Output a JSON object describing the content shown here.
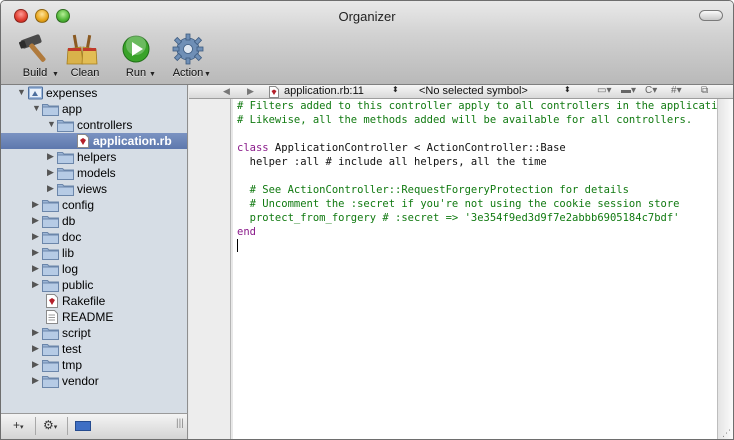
{
  "window": {
    "title": "Organizer"
  },
  "toolbar": {
    "items": [
      {
        "label": "Build",
        "icon": "hammer-icon"
      },
      {
        "label": "Clean",
        "icon": "broom-icon"
      },
      {
        "label": "Run",
        "icon": "run-icon"
      },
      {
        "label": "Action",
        "icon": "gear-icon"
      }
    ]
  },
  "sidebar": {
    "tree": [
      {
        "label": "expenses",
        "icon": "project-icon",
        "expanded": true
      },
      {
        "label": "app",
        "icon": "folder-icon",
        "expanded": true
      },
      {
        "label": "controllers",
        "icon": "folder-icon",
        "expanded": true
      },
      {
        "label": "application.rb",
        "icon": "ruby-file-icon",
        "selected": true
      },
      {
        "label": "helpers",
        "icon": "folder-icon",
        "expanded": false
      },
      {
        "label": "models",
        "icon": "folder-icon",
        "expanded": false
      },
      {
        "label": "views",
        "icon": "folder-icon",
        "expanded": false
      },
      {
        "label": "config",
        "icon": "folder-icon",
        "expanded": false
      },
      {
        "label": "db",
        "icon": "folder-icon",
        "expanded": false
      },
      {
        "label": "doc",
        "icon": "folder-icon",
        "expanded": false
      },
      {
        "label": "lib",
        "icon": "folder-icon",
        "expanded": false
      },
      {
        "label": "log",
        "icon": "folder-icon",
        "expanded": false
      },
      {
        "label": "public",
        "icon": "folder-icon",
        "expanded": false
      },
      {
        "label": "Rakefile",
        "icon": "ruby-file-icon"
      },
      {
        "label": "README",
        "icon": "text-file-icon"
      },
      {
        "label": "script",
        "icon": "folder-icon",
        "expanded": false
      },
      {
        "label": "test",
        "icon": "folder-icon",
        "expanded": false
      },
      {
        "label": "tmp",
        "icon": "folder-icon",
        "expanded": false
      },
      {
        "label": "vendor",
        "icon": "folder-icon",
        "expanded": false
      }
    ]
  },
  "editor": {
    "nav": {
      "file": "application.rb:11",
      "symbol": "<No selected symbol>",
      "counterpart": "C",
      "hash": "#"
    },
    "lines": [
      "# Filters added to this controller apply to all controllers in the application.",
      "# Likewise, all the methods added will be available for all controllers.",
      "",
      "class ApplicationController < ActionController::Base",
      "  helper :all # include all helpers, all the time",
      "",
      "  # See ActionController::RequestForgeryProtection for details",
      "  # Uncomment the :secret if you're not using the cookie session store",
      "  protect_from_forgery # :secret => '3e354f9ed3d9f7e2abbb6905184c7bdf'",
      "end"
    ]
  },
  "colors": {
    "selection": "#6a84b8",
    "sidebar_bg": "#d6dde5",
    "comment": "#117a11",
    "keyword": "#8a1a8a"
  }
}
